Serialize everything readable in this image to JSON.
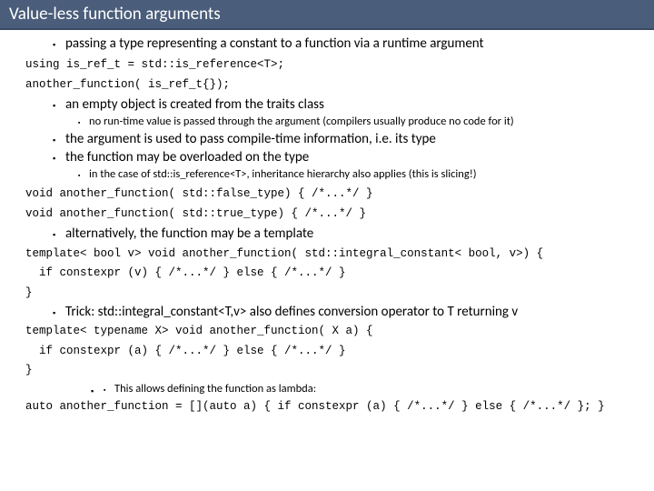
{
  "title": "Value-less function arguments",
  "bullets": {
    "b1": "passing a type representing a constant to a function via a runtime argument",
    "b2": "an empty object is created from the traits class",
    "b2_1": "no run-time value is passed through the argument (compilers usually produce no code for it)",
    "b3": "the argument is used to pass compile-time information, i.e. its type",
    "b4": "the function may be overloaded on the type",
    "b4_1": "in the case of std::is_reference<T>, inheritance hierarchy also applies (this is slicing!)",
    "b5": "alternatively, the function may be a template",
    "b6": "Trick: std::integral_constant<T,v> also defines conversion operator to T returning v",
    "b7": "This allows defining the function as lambda:"
  },
  "code": {
    "c1": "using is_ref_t = std::is_reference<T>;",
    "c2": "another_function( is_ref_t{});",
    "c3": "void another_function( std::false_type) { /*...*/ }",
    "c4": "void another_function( std::true_type) { /*...*/ }",
    "c5a": "template< bool v> void another_function( std::integral_constant< bool, v>) {",
    "c5b": "  if constexpr (v) { /*...*/ } else { /*...*/ }",
    "c5c": "}",
    "c6a": "template< typename X> void another_function( X a) {",
    "c6b": "  if constexpr (a) { /*...*/ } else { /*...*/ }",
    "c6c": "}",
    "c7": "auto another_function = [](auto a) { if constexpr (a) { /*...*/ } else { /*...*/ }; }"
  }
}
